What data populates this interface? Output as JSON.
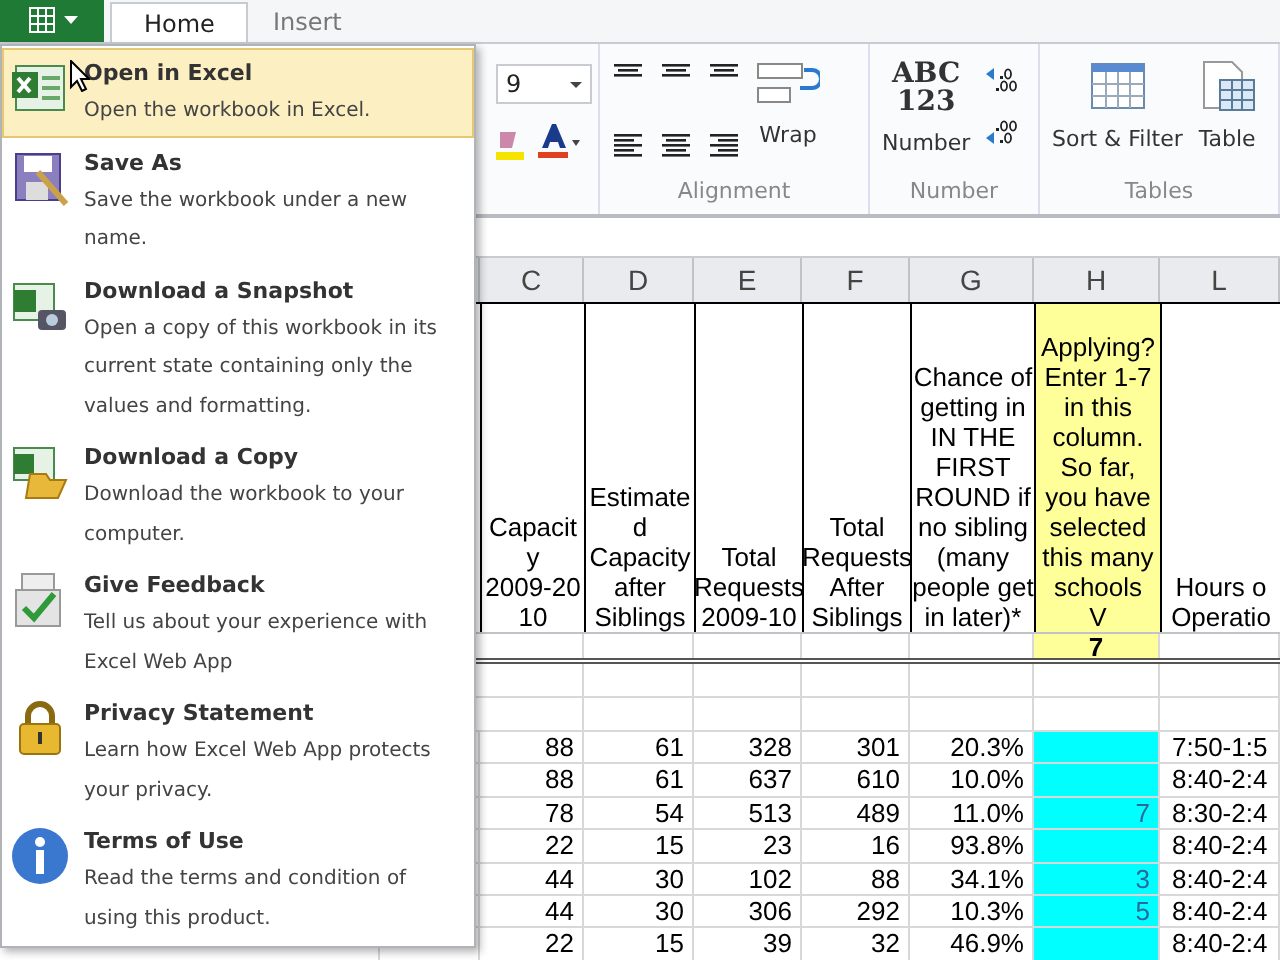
{
  "tabs": [
    {
      "label": "Home",
      "selected": true
    },
    {
      "label": "Insert",
      "selected": false
    }
  ],
  "ribbon": {
    "font_size": "9",
    "groups": [
      {
        "label": "Alignment",
        "buttons": [
          "Wrap"
        ]
      },
      {
        "label": "Number",
        "buttons": [
          "Number"
        ],
        "icon_text": [
          "ABC",
          "123"
        ]
      },
      {
        "label": "Tables",
        "buttons": [
          "Sort & Filter",
          "Table"
        ]
      }
    ]
  },
  "file_menu": {
    "items": [
      {
        "title": "Open in Excel",
        "description": "Open the workbook in Excel.",
        "selected": true
      },
      {
        "title": "Save As",
        "description": "Save the workbook under a new name.",
        "selected": false
      },
      {
        "title": "Download a Snapshot",
        "description": "Open a copy of this workbook in its current state containing only the values and formatting.",
        "selected": false
      },
      {
        "title": "Download a Copy",
        "description": "Download the workbook to your computer.",
        "selected": false
      },
      {
        "title": "Give Feedback",
        "description": "Tell us about your experience with Excel Web App",
        "selected": false
      },
      {
        "title": "Privacy Statement",
        "description": "Learn how Excel Web App protects your privacy.",
        "selected": false
      },
      {
        "title": "Terms of Use",
        "description": "Read the terms and condition of using this product.",
        "selected": false
      }
    ]
  },
  "sheet": {
    "columns": [
      {
        "letter": "C",
        "header": "Capacit\ny\n2009-20\n10"
      },
      {
        "letter": "D",
        "header": "Estimate\nd\nCapacity\nafter\nSiblings"
      },
      {
        "letter": "E",
        "header": "Total\nRequests\n2009-10"
      },
      {
        "letter": "F",
        "header": "Total\nRequests\nAfter\nSiblings"
      },
      {
        "letter": "G",
        "header": "Chance of\ngetting in\nIN THE\nFIRST\nROUND if\nno sibling\n(many\npeople get\nin later)*"
      },
      {
        "letter": "H",
        "header": "Applying?\nEnter 1-7\nin this\ncolumn.\nSo far,\nyou have\nselected\nthis many\nschools\nV",
        "total": "7",
        "color": "#ffff99",
        "input_cells": {
          "color": "#00ffff"
        }
      },
      {
        "letter": "L",
        "header": "Hours o\nOperatio"
      }
    ],
    "rows": [
      {
        "cells": [
          "88",
          "61",
          "328",
          "301",
          "20.3%",
          null,
          "7:50-1:5"
        ]
      },
      {
        "cells": [
          "88",
          "61",
          "637",
          "610",
          "10.0%",
          null,
          "8:40-2:4"
        ]
      },
      {
        "cells": [
          "78",
          "54",
          "513",
          "489",
          "11.0%",
          "7",
          "8:30-2:4"
        ]
      },
      {
        "cells": [
          "22",
          "15",
          "23",
          "16",
          "93.8%",
          null,
          "8:40-2:4"
        ]
      },
      {
        "cells": [
          "44",
          "30",
          "102",
          "88",
          "34.1%",
          "3",
          "8:40-2:4"
        ]
      },
      {
        "cells": [
          "44",
          "30",
          "306",
          "292",
          "10.3%",
          "5",
          "8:40-2:4"
        ]
      },
      {
        "cells": [
          "22",
          "15",
          "39",
          "32",
          "46.9%",
          null,
          "8:40-2:4"
        ]
      }
    ]
  }
}
